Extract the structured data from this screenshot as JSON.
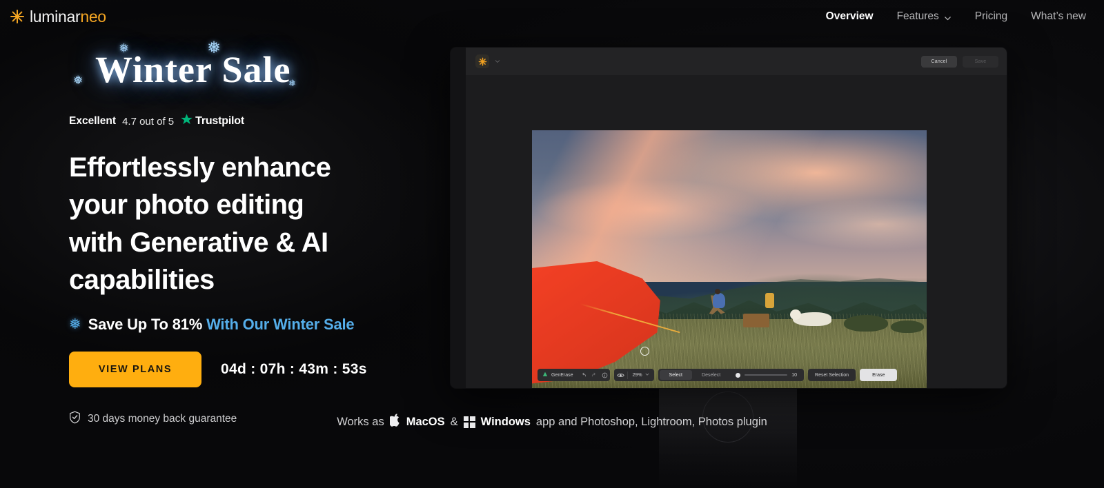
{
  "brand": {
    "logo_icon": "luminar-asterisk-icon",
    "name_primary": "luminar",
    "name_secondary": "neo"
  },
  "nav": {
    "items": [
      {
        "label": "Overview",
        "active": true,
        "has_chevron": false
      },
      {
        "label": "Features",
        "active": false,
        "has_chevron": true
      },
      {
        "label": "Pricing",
        "active": false,
        "has_chevron": false
      },
      {
        "label": "What’s new",
        "active": false,
        "has_chevron": false
      }
    ]
  },
  "hero": {
    "winter_sale_title": "Winter Sale",
    "snowflake_glyph": "❅",
    "trustpilot": {
      "rating_word": "Excellent",
      "score_text": "4.7 out of 5",
      "brand": "Trustpilot",
      "star_icon": "trustpilot-star-icon",
      "star_color": "#00b67a"
    },
    "headline": "Effortlessly enhance your photo editing with Generative & AI capabilities",
    "promo": {
      "flake_icon": "snowflake-icon",
      "white_part": "Save Up To 81%",
      "blue_part": "With Our Winter Sale",
      "blue_color": "#55aeea"
    },
    "cta": {
      "button_label": "VIEW PLANS",
      "button_color": "#ffae0f",
      "countdown": "04d : 07h : 43m : 53s"
    },
    "guarantee": {
      "icon": "shield-check-icon",
      "text": "30 days money back guarantee"
    }
  },
  "app_mockup": {
    "top_bar": {
      "app_icon": "luminar-sun-icon",
      "caret_icon": "chevron-down-icon",
      "cancel_label": "Cancel",
      "save_label": "Save"
    },
    "bottom_bar": {
      "tool_icon": "generase-tool-icon",
      "tool_label": "GenErase",
      "undo_icon": "undo-icon",
      "redo_icon": "redo-icon",
      "info_icon": "info-icon",
      "eye_icon": "eye-icon",
      "zoom_level": "29%",
      "zoom_caret_icon": "chevron-down-icon",
      "select_label": "Select",
      "deselect_label": "Deselect",
      "active_segment": "Select",
      "brush_size": "10",
      "reset_label": "Reset Selection",
      "erase_label": "Erase"
    },
    "photo": {
      "description": "Sunset camping scene with red tent, mountains and white dog",
      "brush_cursor_icon": "brush-cursor-icon"
    }
  },
  "platforms": {
    "prefix": "Works as",
    "apple_icon": "apple-logo-icon",
    "apple_label": "MacOS",
    "ampersand": "&",
    "windows_icon": "windows-logo-icon",
    "windows_label": "Windows",
    "suffix": "app and Photoshop, Lightroom, Photos plugin"
  }
}
